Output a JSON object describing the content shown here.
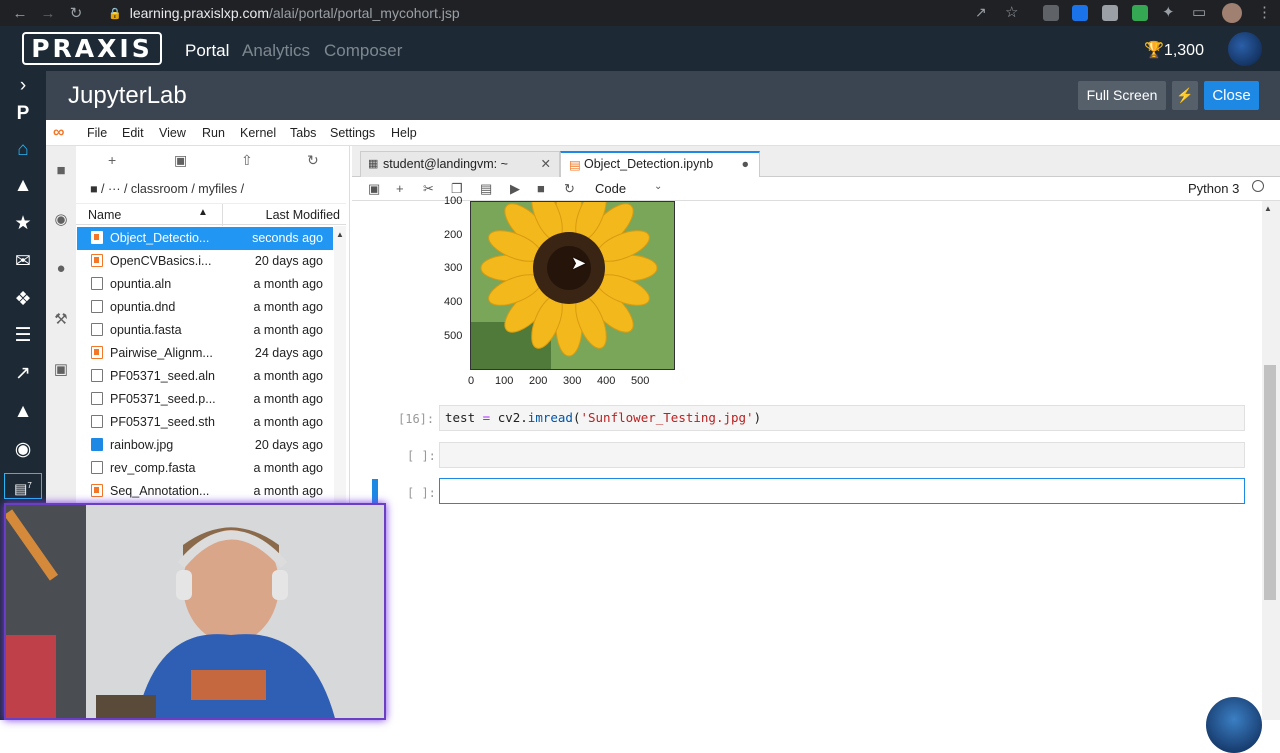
{
  "browser": {
    "url_host": "learning.praxislxp.com",
    "url_path": "/alai/portal/portal_mycohort.jsp"
  },
  "header": {
    "logo": "PRAXIS",
    "nav": [
      {
        "label": "Portal",
        "color": "#ffffff"
      },
      {
        "label": "Analytics",
        "color": "#7d8790"
      },
      {
        "label": "Composer",
        "color": "#7d8790"
      }
    ],
    "points": "1,300"
  },
  "rail": {
    "icons": [
      "chevron-right",
      "p-logo",
      "home",
      "fox",
      "trophy",
      "mail",
      "network",
      "list",
      "chart",
      "graduation",
      "badge",
      "id-card"
    ],
    "id_badge": "7"
  },
  "jupyter": {
    "title": "JupyterLab",
    "full_screen": "Full Screen",
    "close": "Close"
  },
  "menu": [
    "File",
    "Edit",
    "View",
    "Run",
    "Kernel",
    "Tabs",
    "Settings",
    "Help"
  ],
  "filebrowser": {
    "crumbs": "/ ··· / classroom / myfiles /",
    "col_name": "Name",
    "col_modified": "Last Modified",
    "files": [
      {
        "name": "Object_Detectio...",
        "time": "seconds ago",
        "icon": "nb",
        "selected": true
      },
      {
        "name": "OpenCVBasics.i...",
        "time": "20 days ago",
        "icon": "nb"
      },
      {
        "name": "opuntia.aln",
        "time": "a month ago",
        "icon": "file"
      },
      {
        "name": "opuntia.dnd",
        "time": "a month ago",
        "icon": "file"
      },
      {
        "name": "opuntia.fasta",
        "time": "a month ago",
        "icon": "file"
      },
      {
        "name": "Pairwise_Alignm...",
        "time": "24 days ago",
        "icon": "nb"
      },
      {
        "name": "PF05371_seed.aln",
        "time": "a month ago",
        "icon": "file"
      },
      {
        "name": "PF05371_seed.p...",
        "time": "a month ago",
        "icon": "file"
      },
      {
        "name": "PF05371_seed.sth",
        "time": "a month ago",
        "icon": "file"
      },
      {
        "name": "rainbow.jpg",
        "time": "20 days ago",
        "icon": "img"
      },
      {
        "name": "rev_comp.fasta",
        "time": "a month ago",
        "icon": "file"
      },
      {
        "name": "Seq_Annotation...",
        "time": "a month ago",
        "icon": "nb"
      }
    ]
  },
  "tabs": [
    {
      "label": "student@landingvm: ~"
    },
    {
      "label": "Object_Detection.ipynb"
    }
  ],
  "toolbar": {
    "cell_type": "Code",
    "kernel": "Python 3"
  },
  "plot": {
    "yticks": [
      "100",
      "200",
      "300",
      "400",
      "500"
    ],
    "xticks": [
      "0",
      "100",
      "200",
      "300",
      "400",
      "500"
    ]
  },
  "cells": [
    {
      "prompt": "[16]:",
      "code_var": "test",
      "code_op": " = ",
      "code_mod": "cv2.",
      "code_fn": "imread",
      "code_open": "(",
      "code_str": "'Sunflower_Testing.jpg'",
      "code_close": ")"
    },
    {
      "prompt": "[ ]:",
      "code": ""
    },
    {
      "prompt": "[ ]:",
      "code": ""
    }
  ]
}
